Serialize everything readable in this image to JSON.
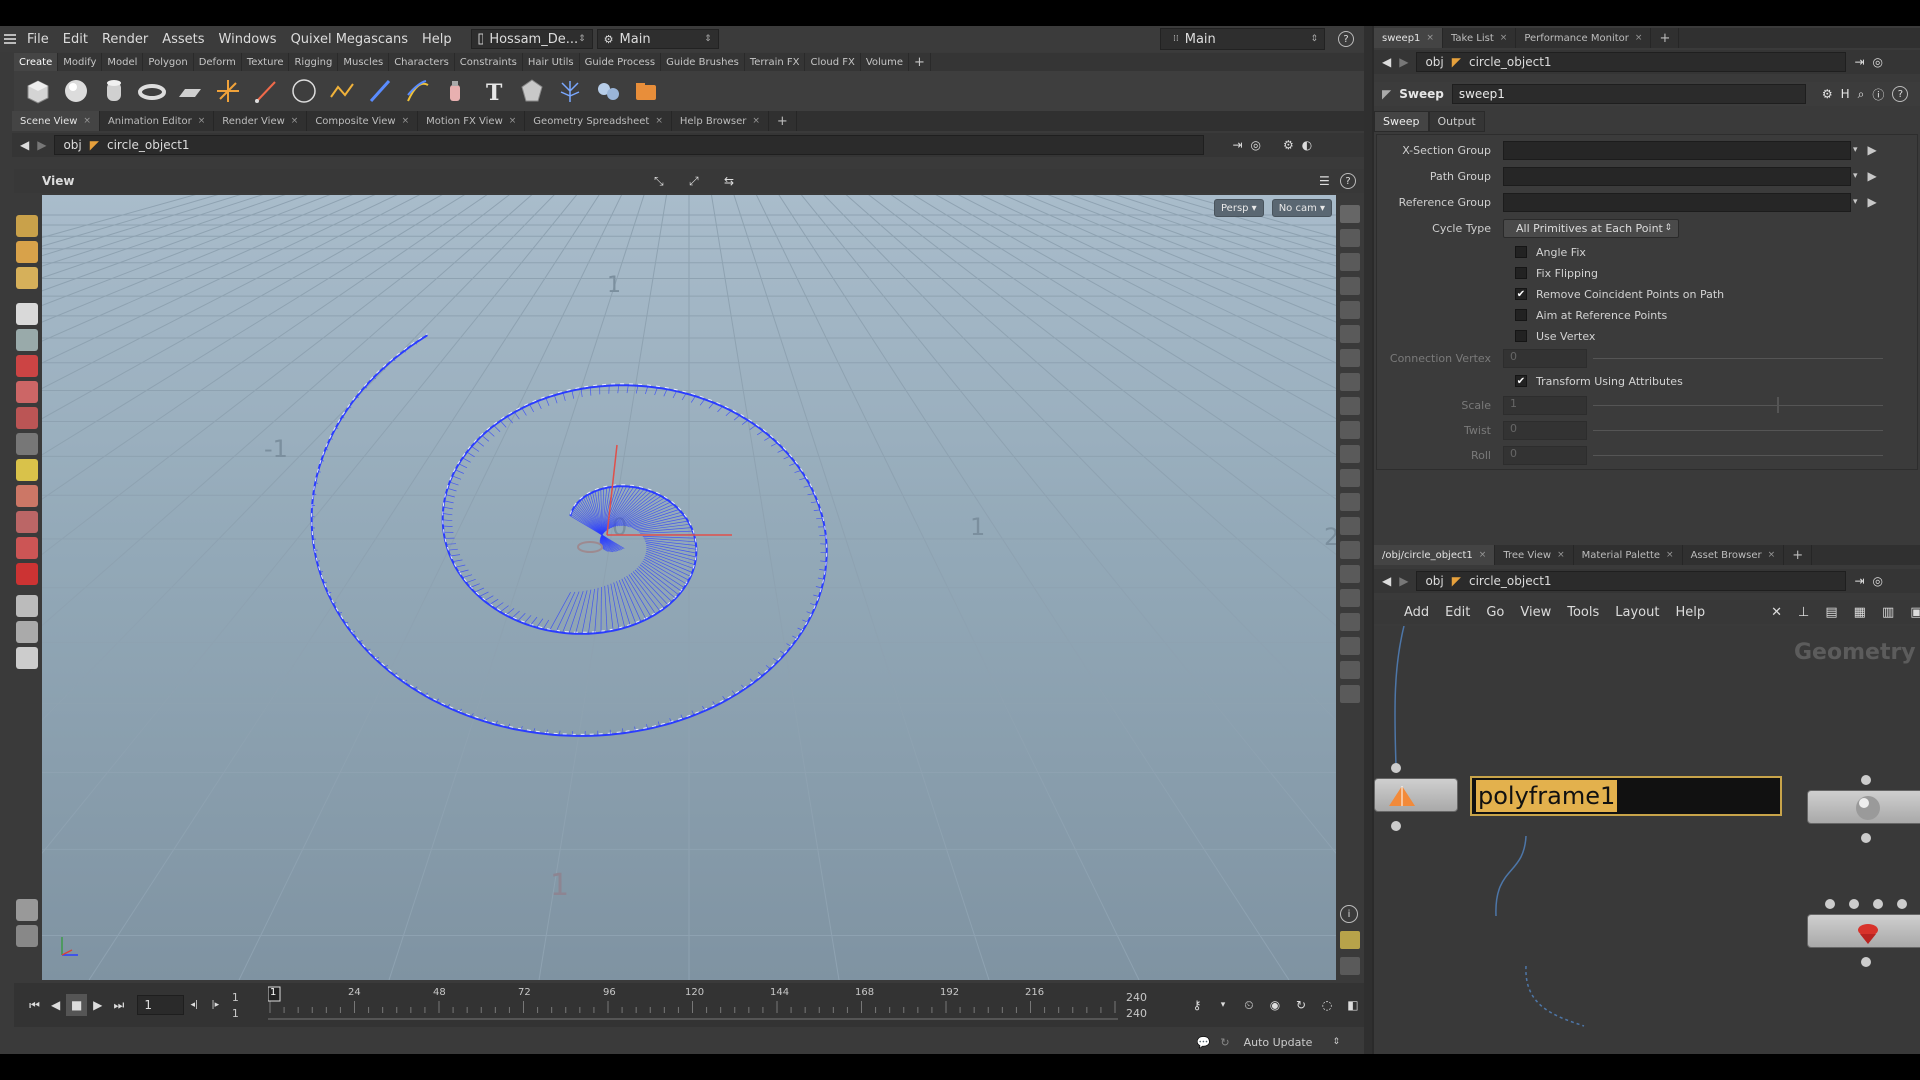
{
  "menu": {
    "items": [
      "File",
      "Edit",
      "Render",
      "Assets",
      "Windows",
      "Quixel Megascans",
      "Help"
    ],
    "desktop": "Hossam_De...",
    "desktop_icon": "window-icon",
    "network": "Main",
    "right_selector": "Main"
  },
  "shelf": {
    "tabs": [
      "Create",
      "Modify",
      "Model",
      "Polygon",
      "Deform",
      "Texture",
      "Rigging",
      "Muscles",
      "Characters",
      "Constraints",
      "Hair Utils",
      "Guide Process",
      "Guide Brushes",
      "Terrain FX",
      "Cloud FX",
      "Volume"
    ],
    "add": "+"
  },
  "pane_tabs": [
    "Scene View",
    "Animation Editor",
    "Render View",
    "Composite View",
    "Motion FX View",
    "Geometry Spreadsheet",
    "Help Browser"
  ],
  "path": {
    "root": "obj",
    "object": "circle_object1"
  },
  "viewport": {
    "title": "View",
    "persp": "Persp ▾",
    "cam": "No cam ▾",
    "grid_labels": [
      "-1",
      "0",
      "1",
      "2",
      "1",
      "1"
    ]
  },
  "timeline": {
    "current_frame": "1",
    "start": "1",
    "start2": "1",
    "ticks": [
      "1",
      "24",
      "48",
      "72",
      "96",
      "120",
      "144",
      "168",
      "192",
      "216"
    ],
    "end": "240",
    "end2": "240"
  },
  "status": {
    "auto_update": "Auto Update"
  },
  "param_pane": {
    "tabs": [
      "sweep1",
      "Take List",
      "Performance Monitor"
    ],
    "path_root": "obj",
    "path_object": "circle_object1",
    "node_type": "Sweep",
    "node_name": "sweep1",
    "subtabs": [
      "Sweep",
      "Output"
    ],
    "xsection_label": "X-Section Group",
    "path_group_label": "Path Group",
    "reference_group_label": "Reference Group",
    "cycle_type_label": "Cycle Type",
    "cycle_type_value": "All Primitives at Each Point",
    "angle_fix": "Angle Fix",
    "fix_flipping": "Fix Flipping",
    "remove_coincident": "Remove Coincident Points on Path",
    "aim_at_reference": "Aim at Reference Points",
    "use_vertex": "Use Vertex",
    "connection_vertex_label": "Connection Vertex",
    "connection_vertex_value": "0",
    "transform_attributes": "Transform Using Attributes",
    "scale_label": "Scale",
    "scale_value": "1",
    "twist_label": "Twist",
    "twist_value": "0",
    "roll_label": "Roll",
    "roll_value": "0",
    "check_mark": "✔"
  },
  "network_pane": {
    "tabs": [
      "/obj/circle_object1",
      "Tree View",
      "Material Palette",
      "Asset Browser"
    ],
    "path_root": "obj",
    "path_object": "circle_object1",
    "menu": [
      "Add",
      "Edit",
      "Go",
      "View",
      "Tools",
      "Layout",
      "Help"
    ],
    "context_label": "Geometry",
    "rename_value": "polyframe1"
  },
  "colors": {
    "curve": "#2a3cff",
    "accent_select": "#e3b14d",
    "background": "#3a3a3a"
  }
}
